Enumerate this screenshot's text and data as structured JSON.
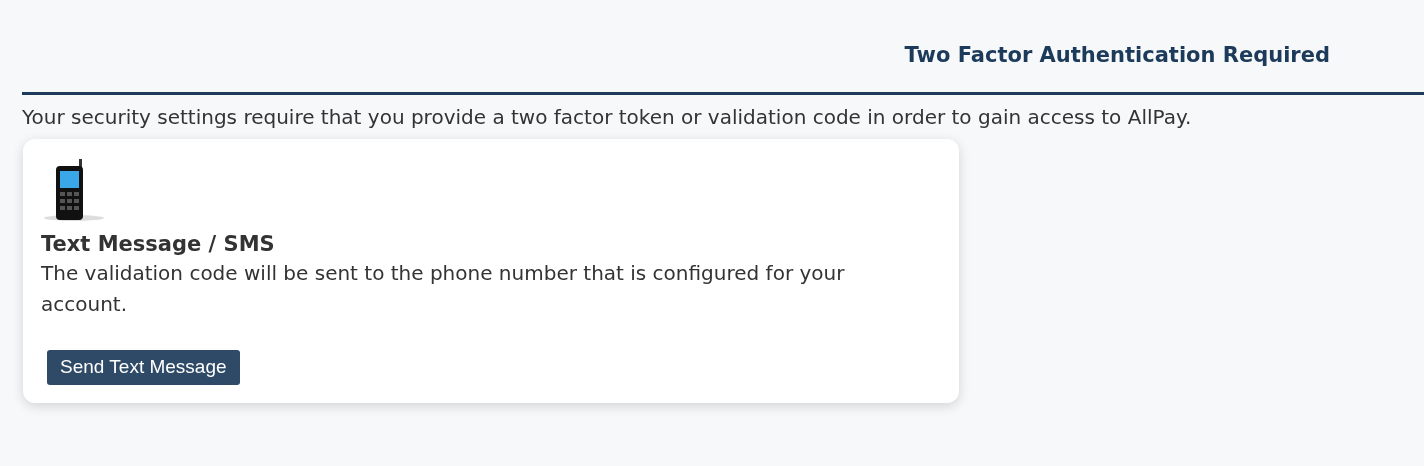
{
  "header": {
    "title": "Two Factor Authentication Required"
  },
  "intro": "Your security settings require that you provide a two factor token or validation code in order to gain access to AllPay.",
  "methods": [
    {
      "title": "Text Message / SMS",
      "description": "The validation code will be sent to the phone number that is configured for your account.",
      "button": "Send Text Message"
    }
  ]
}
